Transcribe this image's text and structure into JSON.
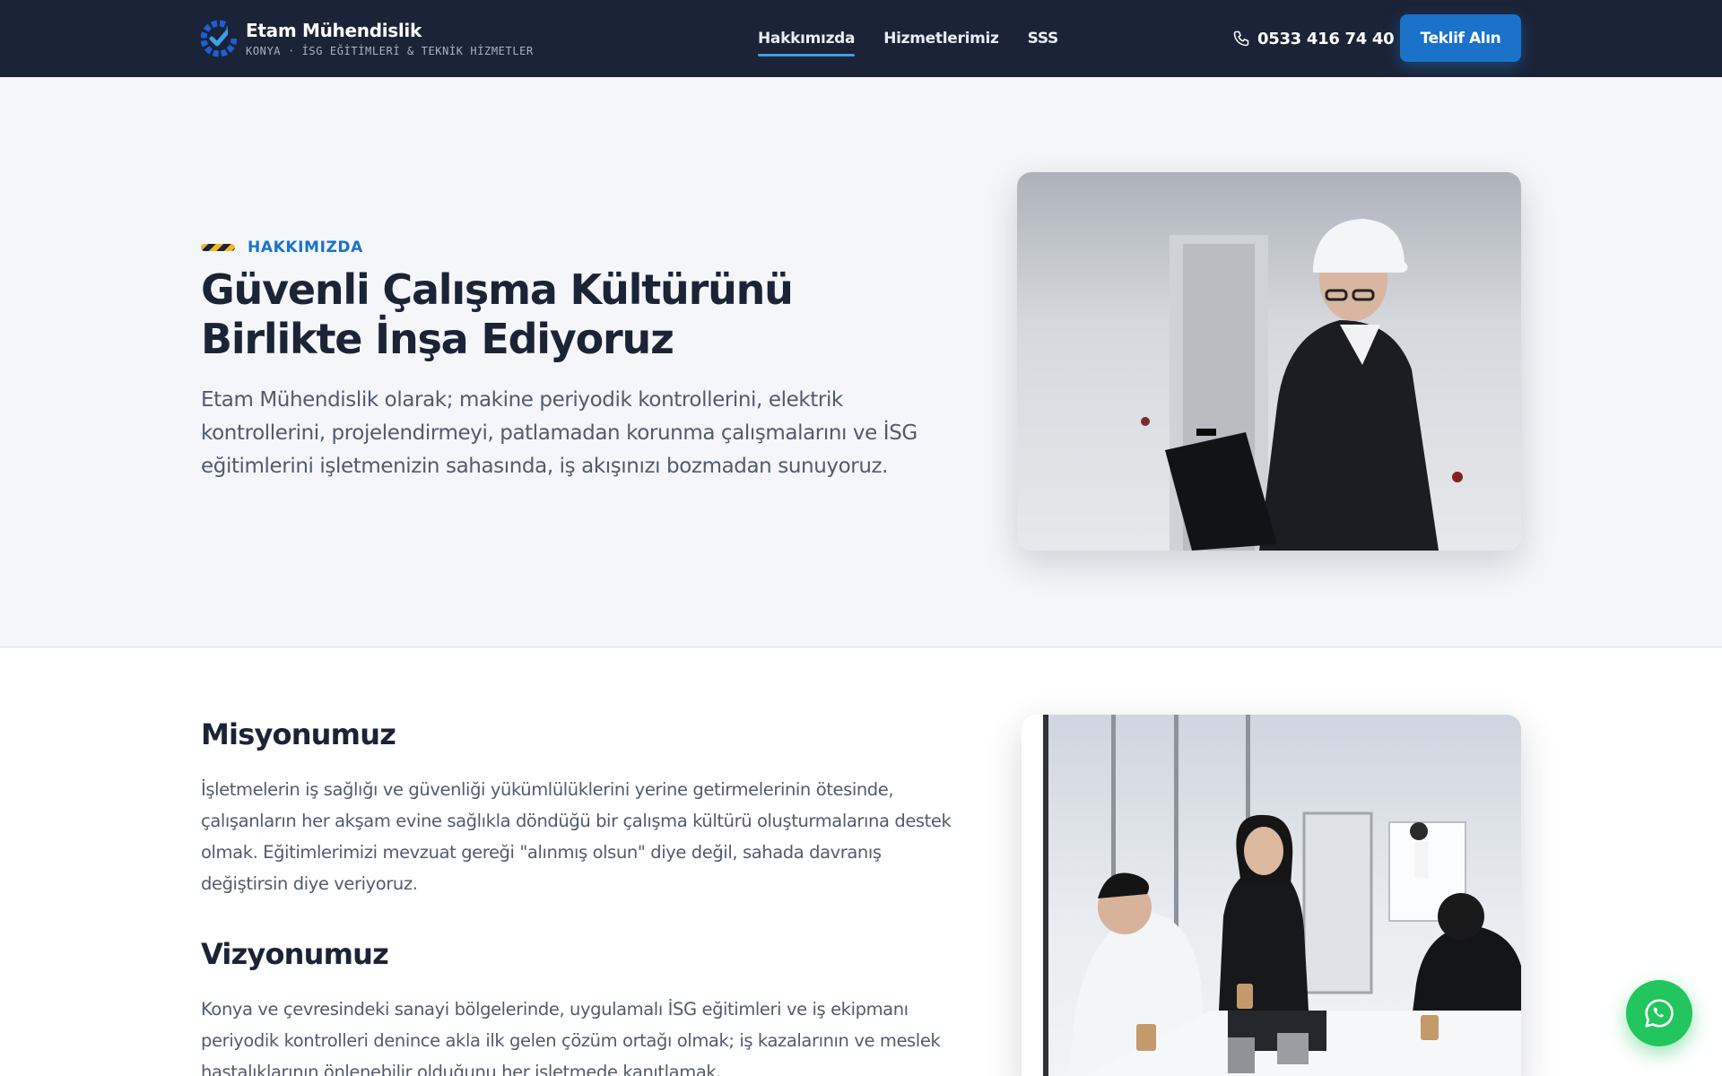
{
  "header": {
    "brand_name": "Etam Mühendislik",
    "brand_tagline": "KONYA · İSG EĞİTİMLERİ & TEKNİK HİZMETLER",
    "nav": [
      {
        "label": "Hakkımızda",
        "active": true
      },
      {
        "label": "Hizmetlerimiz",
        "active": false
      },
      {
        "label": "SSS",
        "active": false
      }
    ],
    "phone": "0533 416 74 40",
    "cta_label": "Teklif Alın"
  },
  "hero": {
    "eyebrow": "HAKKIMIZDA",
    "title_line1": "Güvenli Çalışma Kültürünü",
    "title_line2": "Birlikte İnşa Ediyoruz",
    "description": "Etam Mühendislik olarak; makine periyodik kontrollerini, elektrik kontrollerini, projelendirmeyi, patlamadan korunma çalışmalarını ve İSG eğitimlerini işletmenizin sahasında, iş akışınızı bozmadan sunuyoruz."
  },
  "mission": {
    "title": "Misyonumuz",
    "text": "İşletmelerin iş sağlığı ve güvenliği yükümlülüklerini yerine getirmelerinin ötesinde, çalışanların her akşam evine sağlıkla döndüğü bir çalışma kültürü oluşturmalarına destek olmak. Eğitimlerimizi mevzuat gereği \"alınmış olsun\" diye değil, sahada davranış değiştirsin diye veriyoruz."
  },
  "vision": {
    "title": "Vizyonumuz",
    "text": "Konya ve çevresindeki sanayi bölgelerinde, uygulamalı İSG eğitimleri ve iş ekipmanı periyodik kontrolleri denince akla ilk gelen çözüm ortağı olmak; iş kazalarının ve meslek hastalıklarının önlenebilir olduğunu her işletmede kanıtlamak."
  },
  "colors": {
    "header_bg": "#1b2336",
    "accent": "#1a73c9",
    "whatsapp": "#23c55e"
  }
}
